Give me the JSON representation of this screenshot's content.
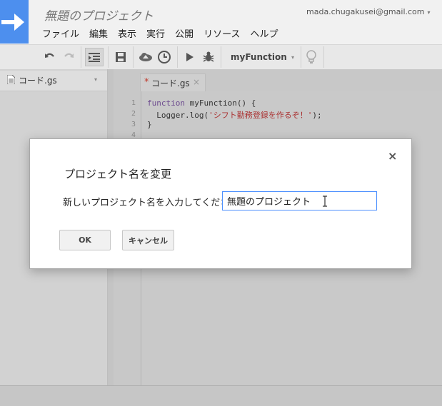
{
  "header": {
    "project_title": "無題のプロジェクト",
    "account_email": "mada.chugakusei@gmail.com",
    "account_caret": "▾",
    "menu": [
      "ファイル",
      "編集",
      "表示",
      "実行",
      "公開",
      "リソース",
      "ヘルプ"
    ]
  },
  "toolbar": {
    "function_select": "myFunction",
    "select_caret": "▾",
    "icons": [
      "undo-icon",
      "redo-icon",
      "indent-icon",
      "save-icon",
      "cloud-upload-icon",
      "clock-trigger-icon",
      "run-icon",
      "debug-bug-icon",
      "lightbulb-icon"
    ]
  },
  "sidebar": {
    "file_label": "コード.gs",
    "caret": "▾"
  },
  "editor": {
    "tab_modified_marker": "*",
    "tab_label": "コード.gs",
    "tab_close": "×",
    "line_numbers": [
      "1",
      "2",
      "3",
      "4"
    ],
    "lines": {
      "l1_keyword": "function",
      "l1_rest": " myFunction() {",
      "l2_pre": "  Logger.log(",
      "l2_string": "'シフト勤務登録を作るぞ！'",
      "l2_post": ");",
      "l3": "}"
    }
  },
  "dialog": {
    "close": "×",
    "title": "プロジェクト名を変更",
    "prompt": "新しいプロジェクト名を入力してください",
    "input_value": "無題のプロジェクト",
    "ok_label": "OK",
    "cancel_label": "キャンセル"
  },
  "colors": {
    "accent": "#4d8fee",
    "input_focus_border": "#4d90fe",
    "string": "#aa3333",
    "keyword": "#6d4c8f"
  }
}
